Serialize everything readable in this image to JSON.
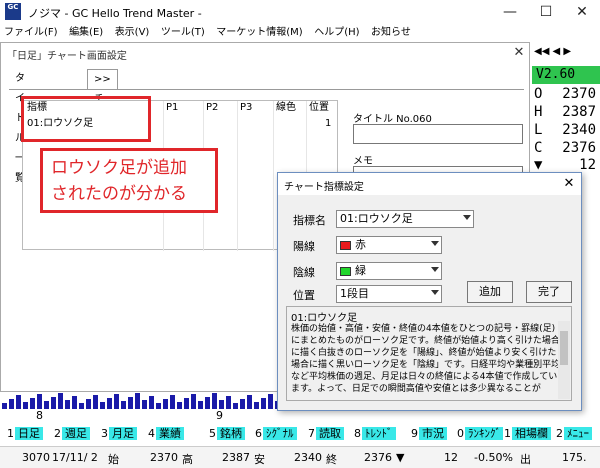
{
  "app": {
    "icon_text": "GC",
    "title": "ノジマ - GC Hello Trend Master -",
    "min": "—",
    "max": "☐",
    "close": "✕"
  },
  "menu": [
    "ファイル(F)",
    "編集(E)",
    "表示(V)",
    "ツール(T)",
    "マーケット情報(M)",
    "ヘルプ(H)",
    "お知らせ"
  ],
  "right_strip": {
    "nav": "◀◀  ◀  ▶",
    "version": "V2.60",
    "ohlc": [
      {
        "k": "O",
        "v": "2370"
      },
      {
        "k": "H",
        "v": "2387"
      },
      {
        "k": "L",
        "v": "2340"
      },
      {
        "k": "C",
        "v": "2376"
      }
    ],
    "change_arrow": "▼",
    "change_value": "12"
  },
  "chart_window": {
    "title": "「日足」チャート画面設定",
    "close": "✕",
    "tabs": [
      "タイトル一覧",
      ">> チャート内容"
    ],
    "grid_headers": [
      "指標",
      "P1",
      "P2",
      "P3",
      "線色",
      "位置"
    ],
    "grid_row": {
      "name": "01:ロウソク足",
      "position": "1"
    },
    "title_label": "タイトル No.060",
    "memo_label": "メモ"
  },
  "annotation": {
    "line1": "ロウソク足が追加",
    "line2": "されたのが分かる"
  },
  "dialog": {
    "title": "チャート指標設定",
    "close": "✕",
    "indicator_label": "指標名",
    "indicator_value": "01:ロウソク足",
    "up_label": "陽線",
    "up_value": "赤",
    "up_color": "#e8191c",
    "down_label": "陰線",
    "down_value": "緑",
    "down_color": "#21d62b",
    "position_label": "位置",
    "position_value": "1段目",
    "add_button": "追加",
    "done_button": "完了",
    "desc_name": "01:ロウソク足",
    "desc_text": "株価の始値・高値・安値・終値の4本値をひとつの記号・罫線(足)にまとめたものがローソク足です。終値が始値より高く引けた場合に描く白抜きのローソク足を「陽線」、終値が始値より安く引けた場合に描く黒いローソク足を「陰線」です。日経平均や業種別平均など平均株価の週足、月足は日々の終値による4本値で作成しています。よって、日足での瞬間高値や安値とは多少異なることが"
  },
  "date_axis": [
    "8",
    "9"
  ],
  "function_keys": [
    {
      "n": "1",
      "label": "日足"
    },
    {
      "n": "2",
      "label": "週足"
    },
    {
      "n": "3",
      "label": "月足"
    },
    {
      "n": "4",
      "label": "業績"
    },
    {
      "n": "5",
      "label": "銘柄"
    },
    {
      "n": "6",
      "label": "ｼｸﾞﾅﾙ"
    },
    {
      "n": "7",
      "label": "読取"
    },
    {
      "n": "8",
      "label": "ﾄﾚﾝﾄﾞ"
    },
    {
      "n": "9",
      "label": "市況"
    },
    {
      "n": "0",
      "label": "ﾗﾝｷﾝｸﾞ"
    },
    {
      "n": "1",
      "label": "相場欄"
    },
    {
      "n": "2",
      "label": "ﾒﾆｭｰ"
    }
  ],
  "status": {
    "code": "3070",
    "date": "17/11/ 2",
    "open_label": "始",
    "open": "2370",
    "high_label": "高",
    "high": "2387",
    "low_label": "安",
    "low": "2340",
    "close_label": "終",
    "close": "2376",
    "arrow": "▼",
    "change": "12",
    "pct": "-0.50%",
    "out_label": "出",
    "volume": "175."
  },
  "colors": {
    "annotation": "#e0262a",
    "function_key": "#39e8e8",
    "version_bg": "#2fc44f",
    "bars": "#1a1aa8"
  }
}
